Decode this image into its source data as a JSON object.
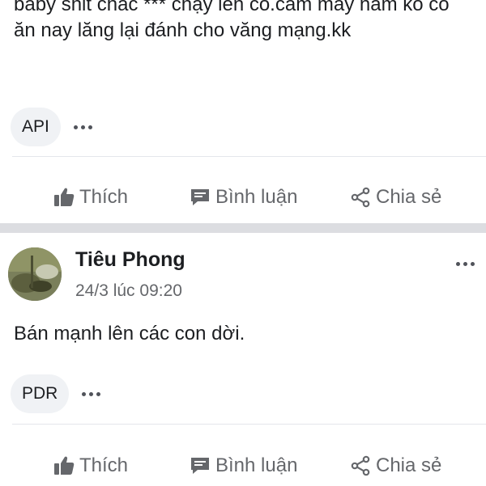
{
  "post1": {
    "text": "baby shit chắc *** chạy lên cô.cầm mấy năm ko có ăn nay lăng lại đánh cho văng mạng.kk",
    "tag": "API",
    "actions": {
      "like": "Thích",
      "comment": "Bình luận",
      "share": "Chia sẻ"
    }
  },
  "post2": {
    "author": "Tiêu Phong",
    "time": "24/3 lúc 09:20",
    "text": "Bán mạnh lên các con dời.",
    "tag": "PDR",
    "actions": {
      "like": "Thích",
      "comment": "Bình luận",
      "share": "Chia sẻ"
    }
  },
  "colors": {
    "text": "#1c1e21",
    "secondary": "#65676b",
    "chip_bg": "#f0f2f5",
    "separator": "#dcdde1"
  },
  "icons": {
    "like": "thumbs-up-icon",
    "comment": "comment-icon",
    "share": "share-icon",
    "more": "more-horizontal-icon"
  }
}
